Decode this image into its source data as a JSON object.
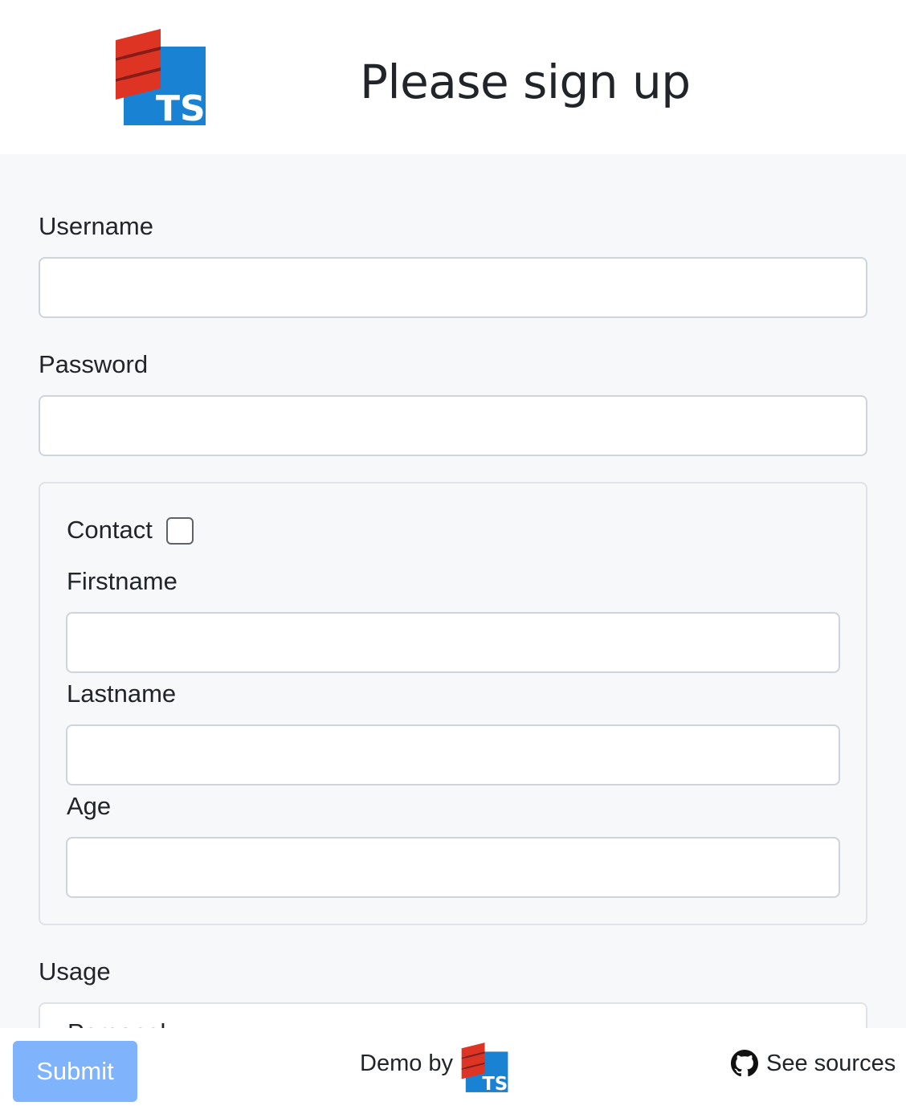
{
  "header": {
    "title": "Please sign up",
    "logo_icon": "scala-ts-logo-icon"
  },
  "form": {
    "username": {
      "label": "Username",
      "value": "",
      "placeholder": ""
    },
    "password": {
      "label": "Password",
      "value": "",
      "placeholder": ""
    },
    "contact": {
      "label": "Contact",
      "checked": false,
      "firstname": {
        "label": "Firstname",
        "value": ""
      },
      "lastname": {
        "label": "Lastname",
        "value": ""
      },
      "age": {
        "label": "Age",
        "value": ""
      }
    },
    "usage": {
      "label": "Usage",
      "visible_option": "Personal"
    }
  },
  "footer": {
    "submit_label": "Submit",
    "demo_by": "Demo by",
    "see_sources": "See sources",
    "github_icon": "github-icon"
  },
  "colors": {
    "header_bg": "#ffffff",
    "page_bg": "#f7f8fa",
    "submit_bg": "#7fb3fb",
    "logo_red": "#de3423",
    "logo_blue": "#1a82d2"
  }
}
